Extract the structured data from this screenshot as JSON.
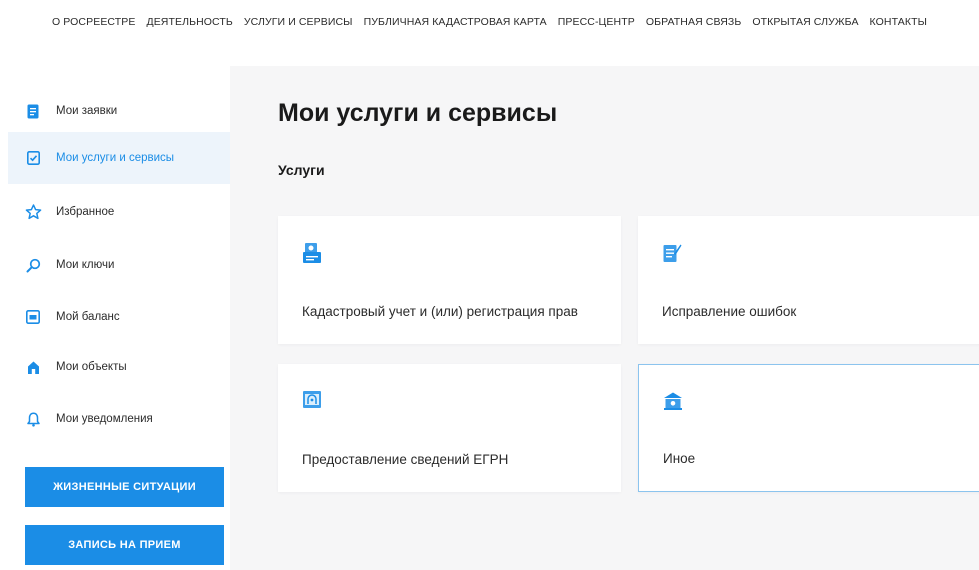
{
  "topnav": {
    "items": [
      "О Росреестре",
      "Деятельность",
      "Услуги и сервисы",
      "Публичная кадастровая карта",
      "Пресс-центр",
      "Обратная связь",
      "Открытая служба",
      "Контакты"
    ]
  },
  "sidebar": {
    "items": [
      {
        "label": "Мои заявки",
        "icon": "document-icon"
      },
      {
        "label": "Мои услуги и сервисы",
        "icon": "checklist-icon"
      },
      {
        "label": "Избранное",
        "icon": "star-icon"
      },
      {
        "label": "Мои ключи",
        "icon": "key-icon"
      },
      {
        "label": "Мой баланс",
        "icon": "wallet-icon"
      },
      {
        "label": "Мои объекты",
        "icon": "house-icon"
      },
      {
        "label": "Мои уведомления",
        "icon": "bell-icon"
      }
    ],
    "active_index": 1,
    "buttons": {
      "life_situations": "Жизненные ситуации",
      "appointment": "Запись на прием"
    }
  },
  "main": {
    "title": "Мои услуги и сервисы",
    "section": "Услуги",
    "cards": [
      {
        "label": "Кадастровый учет и (или) регистрация прав",
        "icon": "certificate-icon"
      },
      {
        "label": "Исправление ошибок",
        "icon": "edit-document-icon"
      },
      {
        "label": "Предоставление сведений ЕГРН",
        "icon": "register-window-icon"
      },
      {
        "label": "Иное",
        "icon": "building-icon"
      }
    ],
    "selected_card_index": 3
  },
  "colors": {
    "accent": "#1b8de6",
    "active_bg": "#edf4fb",
    "main_bg": "#f6f6f7",
    "selected_border": "#8cc4ee"
  }
}
